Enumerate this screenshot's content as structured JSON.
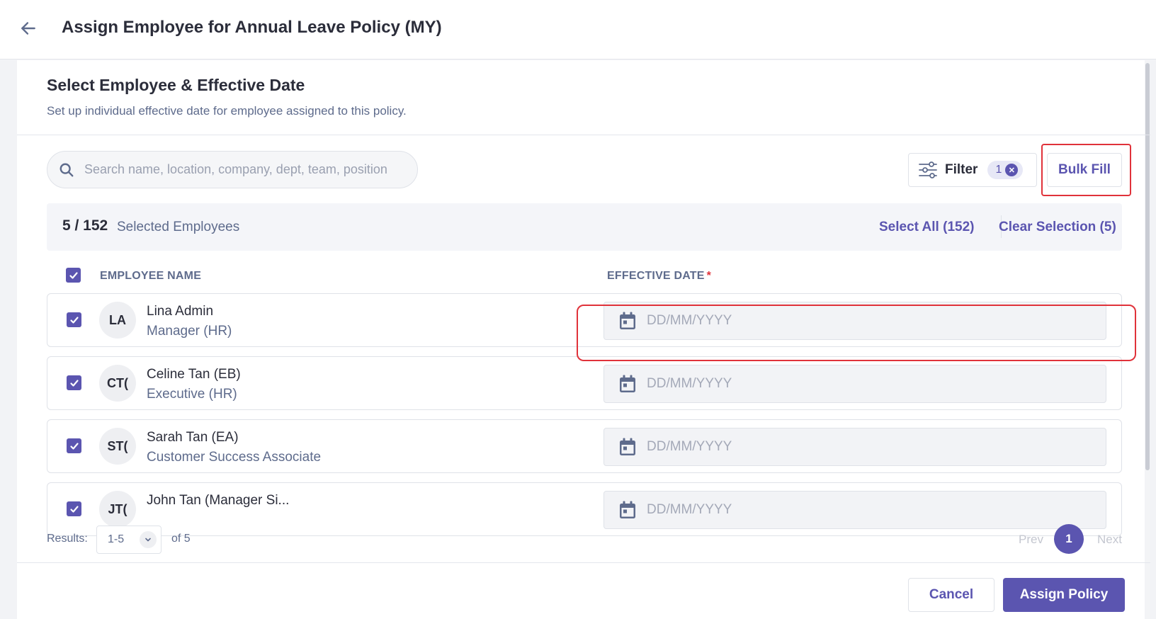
{
  "header": {
    "title": "Assign Employee for Annual Leave Policy (MY)",
    "back_icon": "arrow-left-icon"
  },
  "section": {
    "title": "Select Employee & Effective Date",
    "subtitle": "Set up individual effective date for employee assigned to this policy."
  },
  "search": {
    "placeholder": "Search name, location, company, dept, team, position",
    "value": ""
  },
  "filter": {
    "label": "Filter",
    "count": "1"
  },
  "bulk_fill": {
    "label": "Bulk Fill"
  },
  "selection": {
    "count": "5 / 152",
    "label": "Selected Employees",
    "select_all": "Select All (152)",
    "clear": "Clear Selection (5)"
  },
  "table": {
    "col_name": "EMPLOYEE NAME",
    "col_date": "EFFECTIVE DATE",
    "required_mark": "*",
    "date_placeholder": "DD/MM/YYYY",
    "rows": [
      {
        "initials": "LA",
        "name": "Lina Admin",
        "role": "Manager (HR)",
        "checked": true,
        "date": ""
      },
      {
        "initials": "CT(",
        "name": "Celine Tan (EB)",
        "role": "Executive (HR)",
        "checked": true,
        "date": ""
      },
      {
        "initials": "ST(",
        "name": "Sarah Tan (EA)",
        "role": "Customer Success Associate",
        "checked": true,
        "date": ""
      },
      {
        "initials": "JT(",
        "name": "John Tan (Manager Si...",
        "role": "",
        "checked": true,
        "date": ""
      }
    ]
  },
  "pagination": {
    "results_label": "Results:",
    "range": "1-5",
    "of": "of 5",
    "prev": "Prev",
    "current": "1",
    "next": "Next"
  },
  "footer": {
    "cancel": "Cancel",
    "assign": "Assign Policy"
  },
  "colors": {
    "primary": "#5b55b0",
    "highlight": "#e0323a",
    "muted_text": "#5e6b8c"
  }
}
